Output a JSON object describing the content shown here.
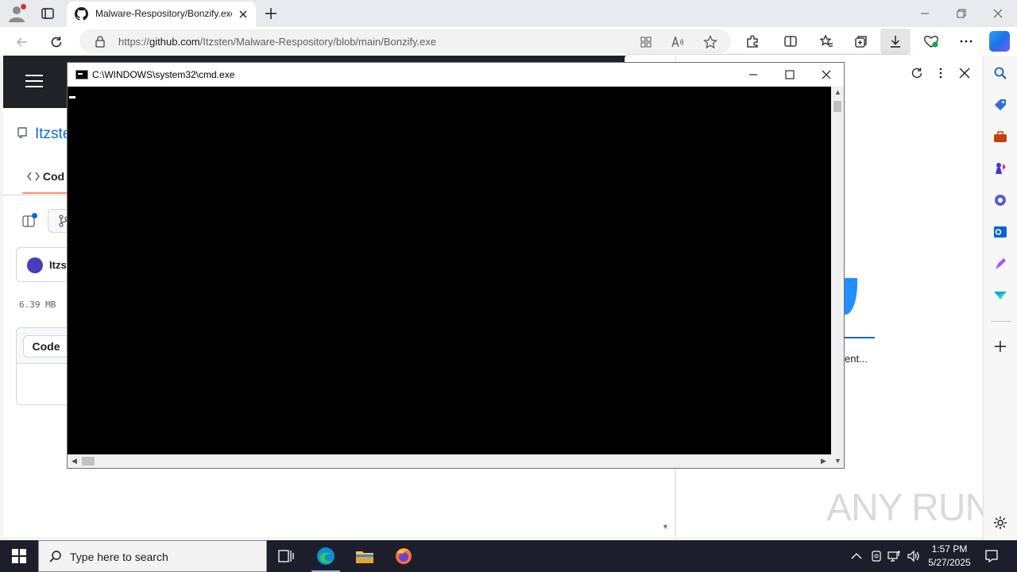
{
  "browser": {
    "tab_title": "Malware-Respository/Bonzify.exe",
    "url_prefix": "https://",
    "url_domain": "github.com",
    "url_path": "/Itzsten/Malware-Respository/blob/main/Bonzify.exe"
  },
  "github": {
    "repo_name": "Itzste",
    "code_tab": "Cod",
    "author_name": "Itzst",
    "file_size": "6.39 MB",
    "code_button": "Code"
  },
  "side_panel": {
    "status_text": "ent..."
  },
  "watermark": "ANY RUN",
  "cmd": {
    "title": "C:\\WINDOWS\\system32\\cmd.exe"
  },
  "taskbar": {
    "search_placeholder": "Type here to search",
    "time": "1:57 PM",
    "date": "5/27/2025"
  },
  "colors": {
    "github_header": "#1f2328",
    "link_blue": "#0969da",
    "taskbar": "#1c1f2b"
  }
}
